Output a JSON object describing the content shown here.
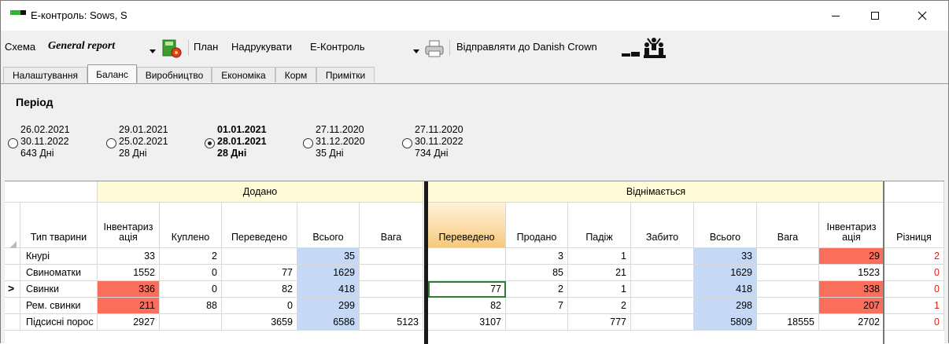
{
  "window": {
    "title": "E-контроль: Sows, S"
  },
  "toolbar": {
    "scheme_label": "Схема",
    "scheme_value": "General report",
    "plan_label": "План",
    "print_label": "Надрукувати",
    "print_value": "E-Контроль",
    "send_label": "Відправляти до Danish Crown"
  },
  "tabs": [
    "Налаштування",
    "Баланс",
    "Виробництво",
    "Економіка",
    "Корм",
    "Примітки"
  ],
  "period": {
    "title": "Період",
    "options": [
      {
        "from": "26.02.2021",
        "to": "30.11.2022",
        "days": "643 Дні",
        "selected": false
      },
      {
        "from": "29.01.2021",
        "to": "25.02.2021",
        "days": "28 Дні",
        "selected": false
      },
      {
        "from": "01.01.2021",
        "to": "28.01.2021",
        "days": "28 Дні",
        "selected": true
      },
      {
        "from": "27.11.2020",
        "to": "31.12.2020",
        "days": "35 Дні",
        "selected": false
      },
      {
        "from": "27.11.2020",
        "to": "30.11.2022",
        "days": "734 Дні",
        "selected": false
      }
    ]
  },
  "grid": {
    "group_added": "Додано",
    "group_subtracted": "Віднімається",
    "columns": [
      "Тип тварини",
      "Інвентариз ація",
      "Куплено",
      "Переведено",
      "Всього",
      "Вага",
      "Переведено",
      "Продано",
      "Падіж",
      "Забито",
      "Всього",
      "Вага",
      "Інвентариз ація",
      "Різниця"
    ],
    "rows": [
      {
        "marker": "",
        "cells": [
          "Кнурі",
          "33",
          "2",
          "",
          "35",
          "",
          "",
          "3",
          "1",
          "",
          "33",
          "",
          "29",
          "2"
        ]
      },
      {
        "marker": "",
        "cells": [
          "Свиноматки",
          "1552",
          "0",
          "77",
          "1629",
          "",
          "",
          "85",
          "21",
          "",
          "1629",
          "",
          "1523",
          "0"
        ]
      },
      {
        "marker": ">",
        "cells": [
          "Свинки",
          "336",
          "0",
          "82",
          "418",
          "",
          "77",
          "2",
          "1",
          "",
          "418",
          "",
          "338",
          "0"
        ]
      },
      {
        "marker": "",
        "cells": [
          "Рем. свинки",
          "211",
          "88",
          "0",
          "299",
          "",
          "82",
          "7",
          "2",
          "",
          "298",
          "",
          "207",
          "1"
        ]
      },
      {
        "marker": "",
        "cells": [
          "Підсисні порос",
          "2927",
          "",
          "3659",
          "6586",
          "5123",
          "3107",
          "",
          "777",
          "",
          "5809",
          "18555",
          "2702",
          "0"
        ]
      }
    ]
  },
  "colors": {
    "header_yellow": "#fffad7",
    "total_blue": "#c5d9f7",
    "alert_red": "#f96f5b",
    "diff_red": "#e0201a",
    "current_cell_border": "#2e7d32"
  }
}
